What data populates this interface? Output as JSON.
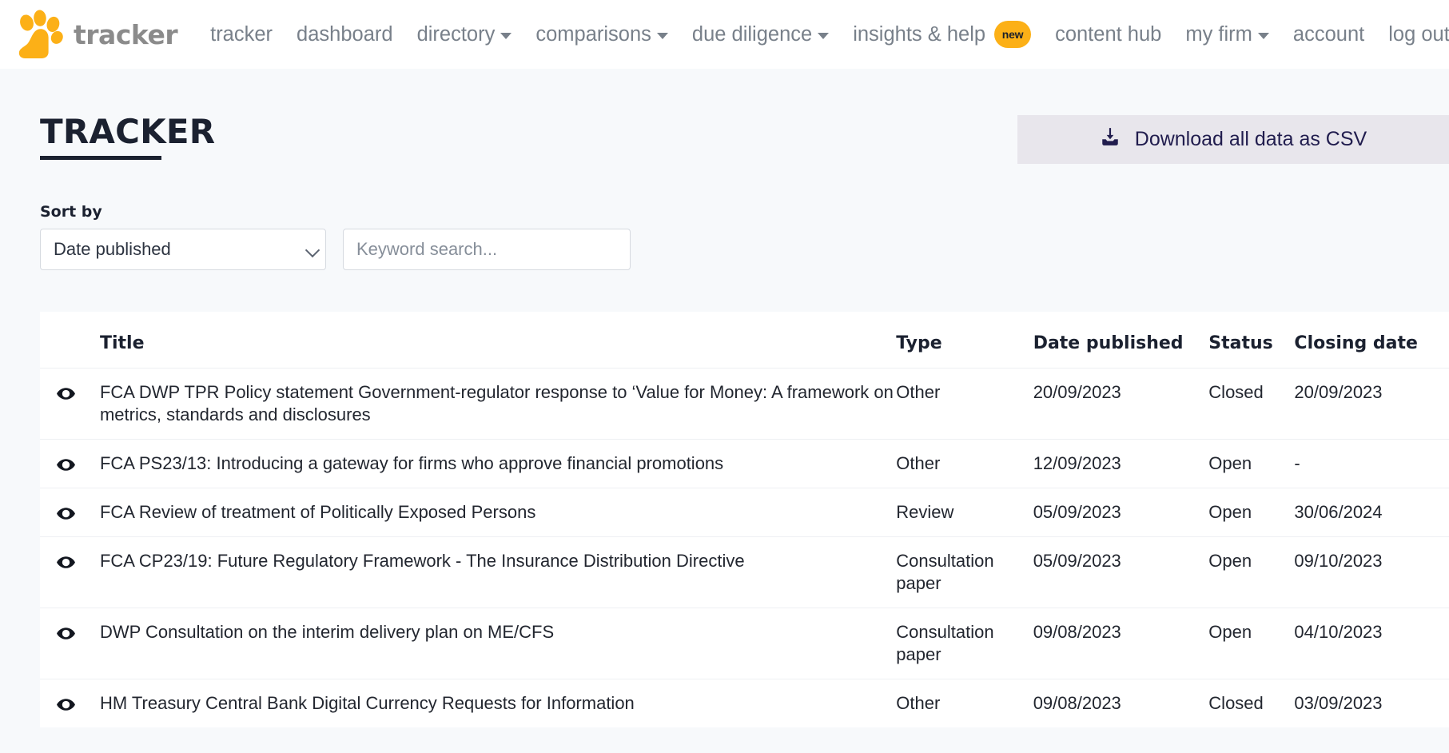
{
  "brand": {
    "logo_icon": "paw-logo-icon",
    "word": "tracker",
    "color": "#fcb017"
  },
  "nav": {
    "items": [
      {
        "label": "tracker",
        "has_caret": false
      },
      {
        "label": "dashboard",
        "has_caret": false
      },
      {
        "label": "directory",
        "has_caret": true
      },
      {
        "label": "comparisons",
        "has_caret": true
      },
      {
        "label": "due diligence",
        "has_caret": true
      },
      {
        "label": "insights & help",
        "has_caret": false,
        "badge": "new"
      },
      {
        "label": "content hub",
        "has_caret": false
      },
      {
        "label": "my firm",
        "has_caret": true
      },
      {
        "label": "account",
        "has_caret": false
      },
      {
        "label": "log out",
        "has_caret": false
      }
    ]
  },
  "header": {
    "title": "TRACKER",
    "download_label": "Download all data as CSV",
    "download_icon": "download-tray-icon"
  },
  "filters": {
    "sort_label": "Sort by",
    "sort_value": "Date published",
    "sort_options": [
      "Date published"
    ],
    "search_placeholder": "Keyword search...",
    "search_value": ""
  },
  "table": {
    "columns": [
      "",
      "Title",
      "Type",
      "Date published",
      "Status",
      "Closing date"
    ],
    "rows": [
      {
        "title": "FCA DWP TPR Policy statement Government-regulator response to ‘Value for Money: A framework on metrics, standards and disclosures",
        "type": "Other",
        "date_published": "20/09/2023",
        "status": "Closed",
        "closing_date": "20/09/2023"
      },
      {
        "title": "FCA PS23/13: Introducing a gateway for firms who approve financial promotions",
        "type": "Other",
        "date_published": "12/09/2023",
        "status": "Open",
        "closing_date": "-"
      },
      {
        "title": "FCA Review of treatment of Politically Exposed Persons",
        "type": "Review",
        "date_published": "05/09/2023",
        "status": "Open",
        "closing_date": "30/06/2024"
      },
      {
        "title": "FCA CP23/19: Future Regulatory Framework - The Insurance Distribution Directive",
        "type": "Consultation paper",
        "date_published": "05/09/2023",
        "status": "Open",
        "closing_date": "09/10/2023"
      },
      {
        "title": "DWP Consultation on the interim delivery plan on ME/CFS",
        "type": "Consultation paper",
        "date_published": "09/08/2023",
        "status": "Open",
        "closing_date": "04/10/2023"
      },
      {
        "title": "HM Treasury Central Bank Digital Currency Requests for Information",
        "type": "Other",
        "date_published": "09/08/2023",
        "status": "Closed",
        "closing_date": "03/09/2023"
      }
    ]
  }
}
